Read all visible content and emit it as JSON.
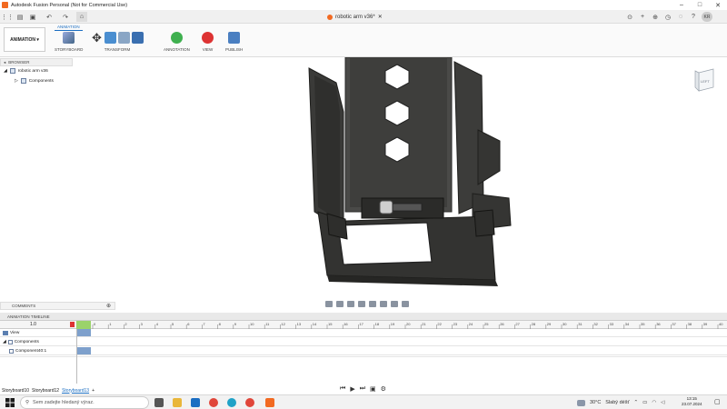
{
  "window": {
    "title": "Autodesk Fusion Personal (Not for Commercial Use)"
  },
  "document_tab": {
    "label": "robotic arm v36*"
  },
  "ribbon": {
    "workspace": "ANIMATION",
    "tabs": [
      "ANIMATION"
    ],
    "groups": [
      {
        "label": "STORYBOARD"
      },
      {
        "label": "TRANSFORM"
      },
      {
        "label": "ANNOTATION"
      },
      {
        "label": "VIEW"
      },
      {
        "label": "PUBLISH"
      }
    ]
  },
  "browser": {
    "header": "BROWSER",
    "root": "robotic arm v36",
    "items": [
      "Components"
    ]
  },
  "viewcube": {
    "face": "LEFT"
  },
  "comments": {
    "label": "COMMENTS"
  },
  "timeline": {
    "header": "ANIMATION TIMELINE",
    "current_value": "1.0",
    "tick_labels": [
      "0",
      "1",
      "2",
      "3",
      "4",
      "5",
      "6",
      "7",
      "8",
      "9",
      "10",
      "11",
      "12",
      "13",
      "14",
      "15",
      "16",
      "17",
      "18",
      "19",
      "20",
      "21",
      "22",
      "23",
      "24",
      "25",
      "26",
      "27",
      "28",
      "29",
      "30",
      "31",
      "32",
      "33",
      "34",
      "35",
      "36",
      "37",
      "38",
      "39",
      "40"
    ],
    "rows": [
      {
        "label": "View"
      },
      {
        "label": "Components"
      },
      {
        "label": "Component40:1"
      }
    ]
  },
  "storyboards": {
    "tabs": [
      "Storyboard10",
      "Storyboard12",
      "Storyboard13"
    ],
    "active": "Storyboard13"
  },
  "taskbar": {
    "search_placeholder": "Sem zadejte hledaný výraz.",
    "weather_temp": "30°C",
    "weather_text": "Slabý déšť",
    "time": "13:15",
    "date": "23.07.2024"
  }
}
